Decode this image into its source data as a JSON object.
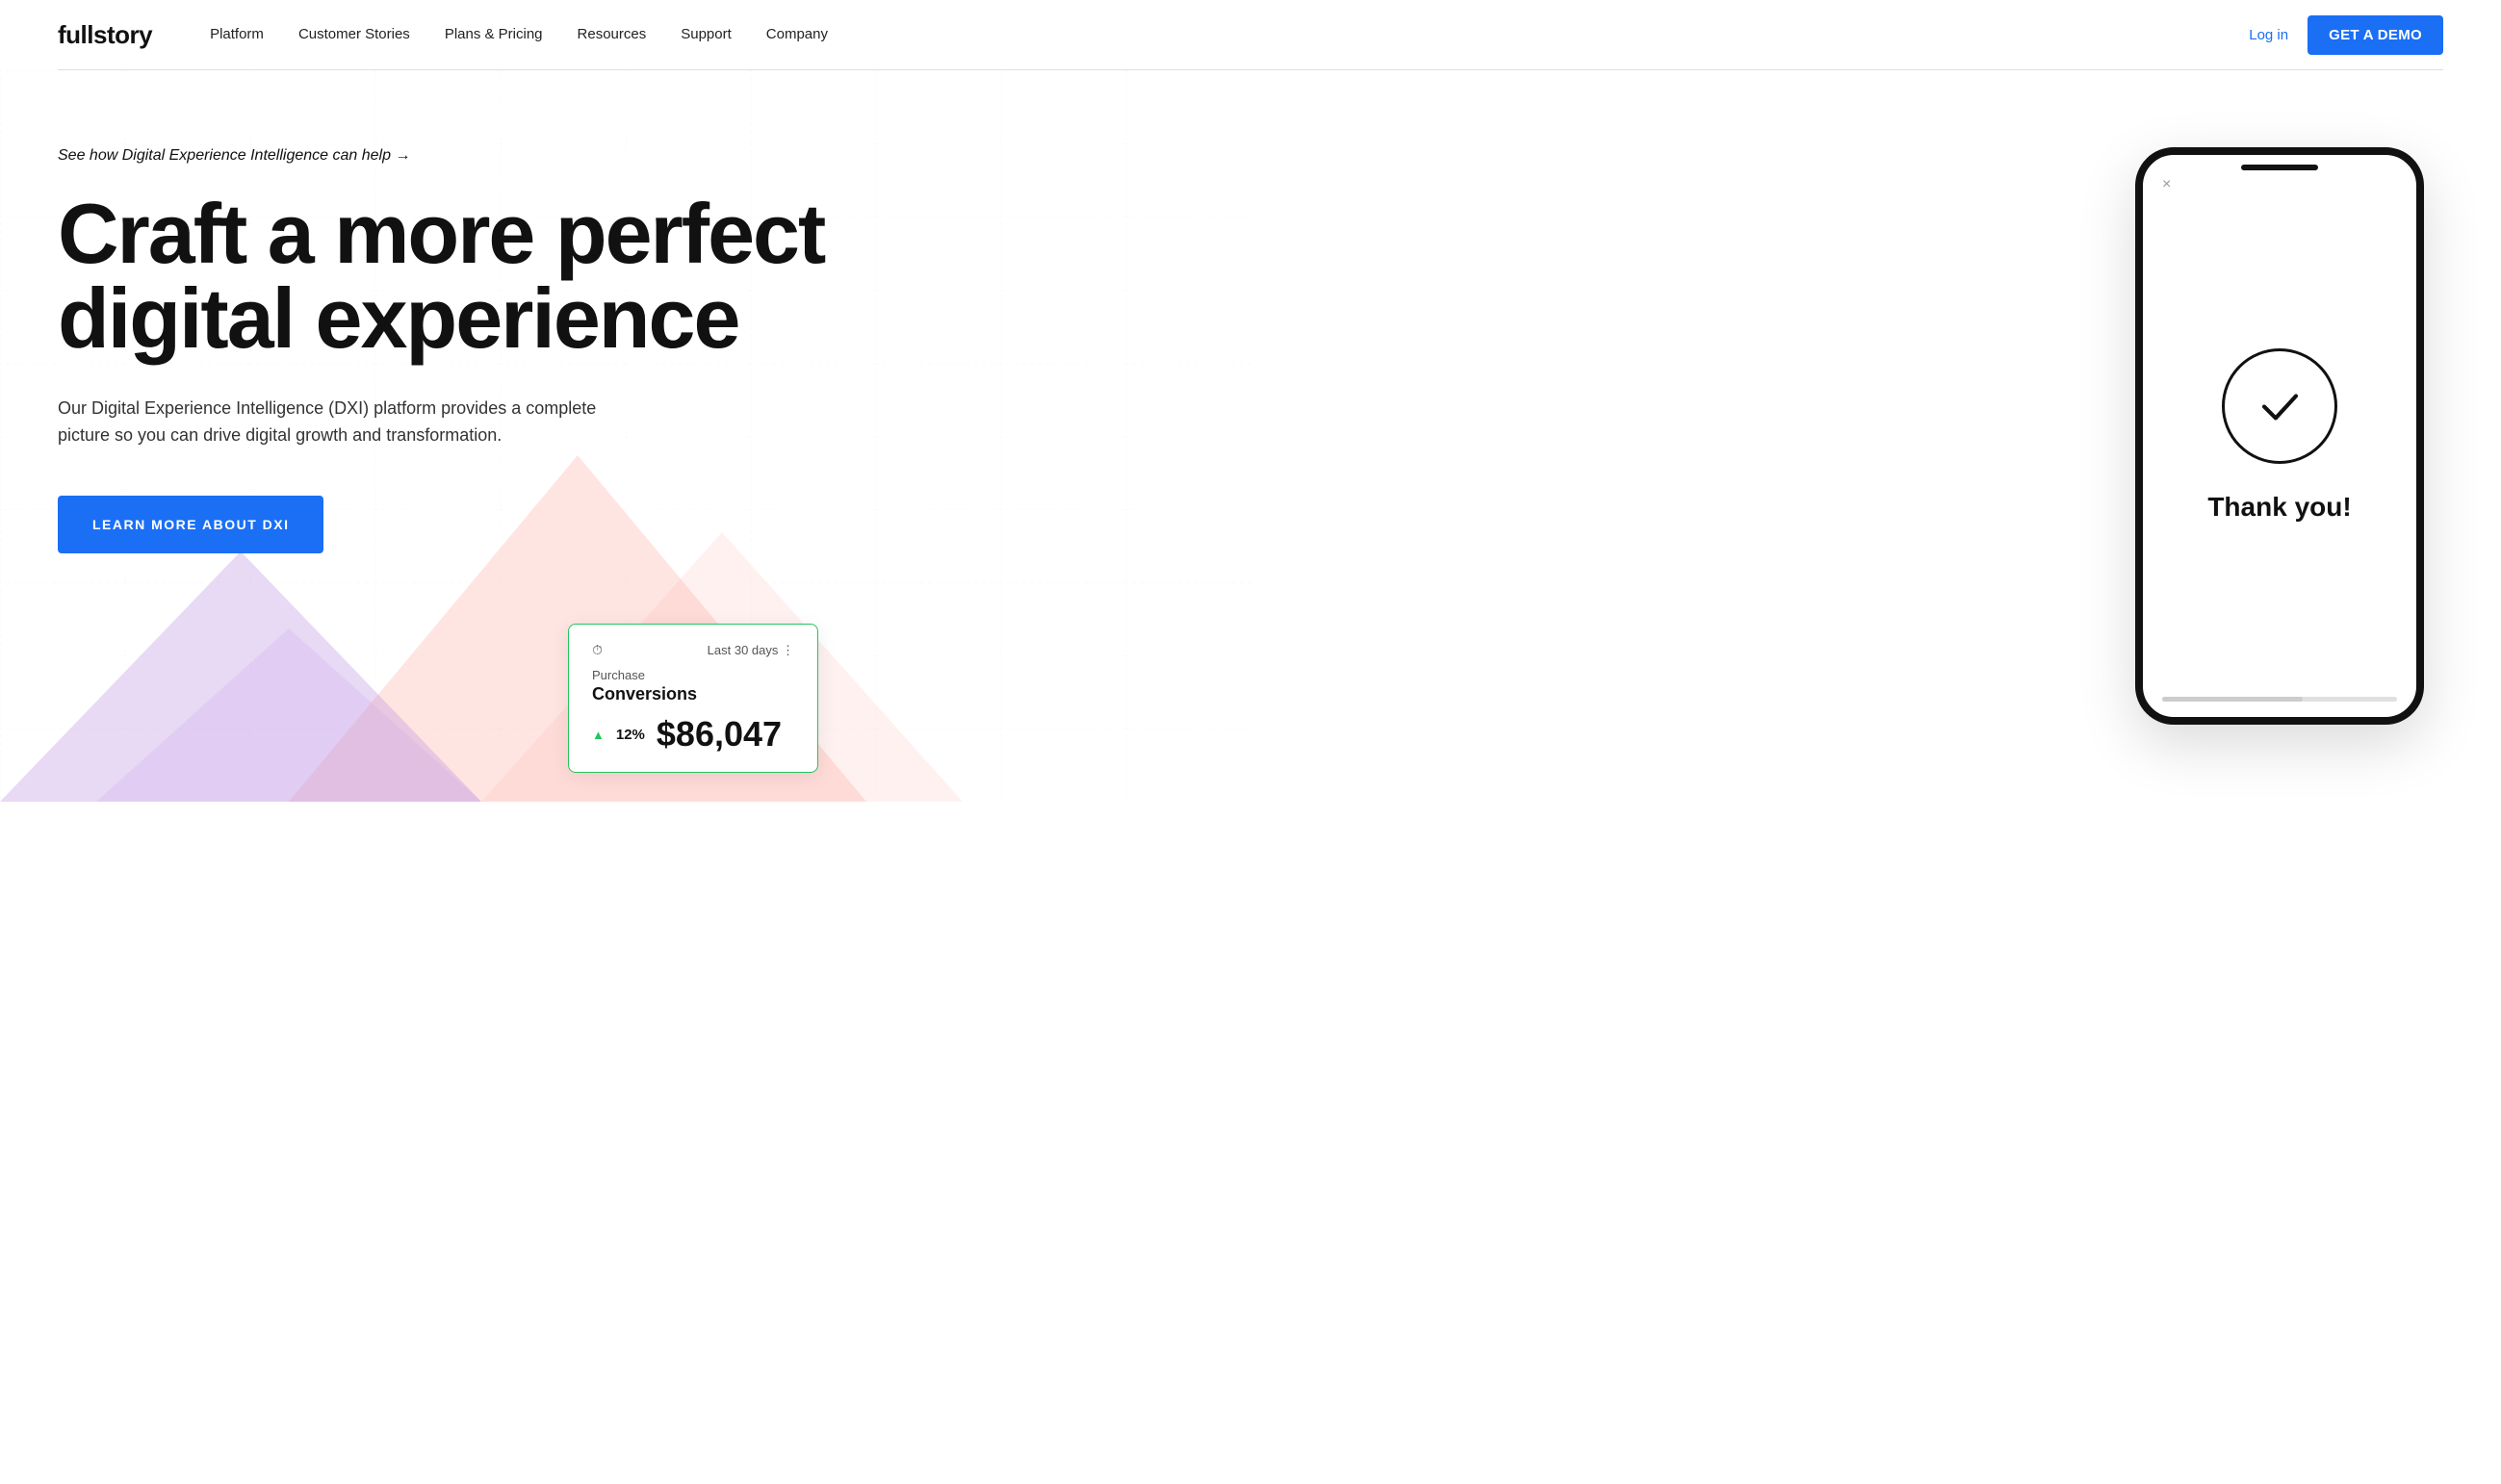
{
  "nav": {
    "logo": "fullstory",
    "links": [
      {
        "label": "Platform",
        "id": "platform"
      },
      {
        "label": "Customer Stories",
        "id": "customer-stories"
      },
      {
        "label": "Plans & Pricing",
        "id": "plans-pricing"
      },
      {
        "label": "Resources",
        "id": "resources"
      },
      {
        "label": "Support",
        "id": "support"
      },
      {
        "label": "Company",
        "id": "company"
      }
    ],
    "login_label": "Log in",
    "demo_label": "GET A DEMO"
  },
  "hero": {
    "tag_text": "See how Digital Experience Intelligence can help →",
    "headline_line1": "Craft a more perfect",
    "headline_line2": "digital experience",
    "subtext": "Our Digital Experience Intelligence (DXI) platform provides a complete picture so you can drive digital growth and transformation.",
    "cta_label": "LEARN MORE ABOUT DXI"
  },
  "conversion_card": {
    "period": "Last 30 days ⋮",
    "title": "Purchase",
    "label": "Conversions",
    "change_pct": "12%",
    "amount": "$86,047"
  },
  "phone": {
    "close_icon": "×",
    "thank_you": "Thank you!"
  },
  "colors": {
    "accent_blue": "#1a6ff5",
    "green": "#22c55e",
    "dark": "#111111"
  }
}
